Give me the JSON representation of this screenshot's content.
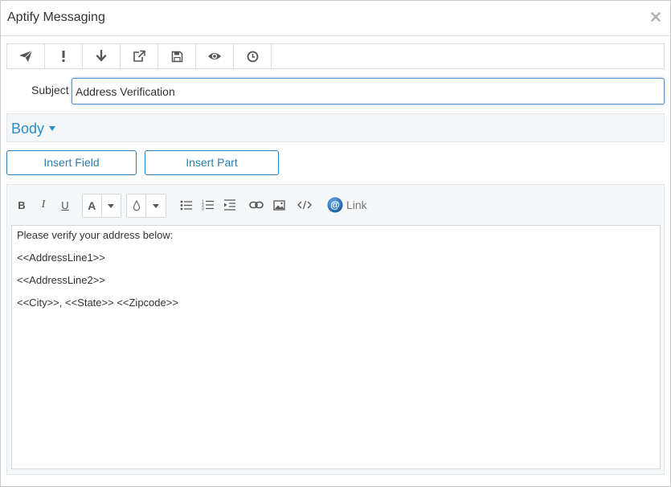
{
  "window": {
    "title": "Aptify Messaging"
  },
  "toolbar": {
    "buttons": [
      {
        "icon": "send-icon"
      },
      {
        "icon": "priority-icon"
      },
      {
        "icon": "download-icon"
      },
      {
        "icon": "external-link-icon"
      },
      {
        "icon": "save-icon"
      },
      {
        "icon": "preview-icon"
      },
      {
        "icon": "schedule-icon"
      }
    ]
  },
  "subject": {
    "label": "Subject",
    "value": "Address Verification"
  },
  "body_section": {
    "title": "Body"
  },
  "actions": {
    "insert_field": "Insert Field",
    "insert_part": "Insert Part"
  },
  "editor": {
    "toolbar": {
      "bold": "B",
      "italic": "I",
      "underline": "U",
      "font_color": "A",
      "link_label": "Link"
    },
    "lines": [
      "Please verify your address below:",
      "<<AddressLine1>>",
      "<<AddressLine2>>",
      "<<City>>, <<State>> <<Zipcode>>"
    ]
  },
  "colors": {
    "accent": "#2b8dc6",
    "border": "#dcdcdc",
    "panel": "#f4f6f8"
  }
}
